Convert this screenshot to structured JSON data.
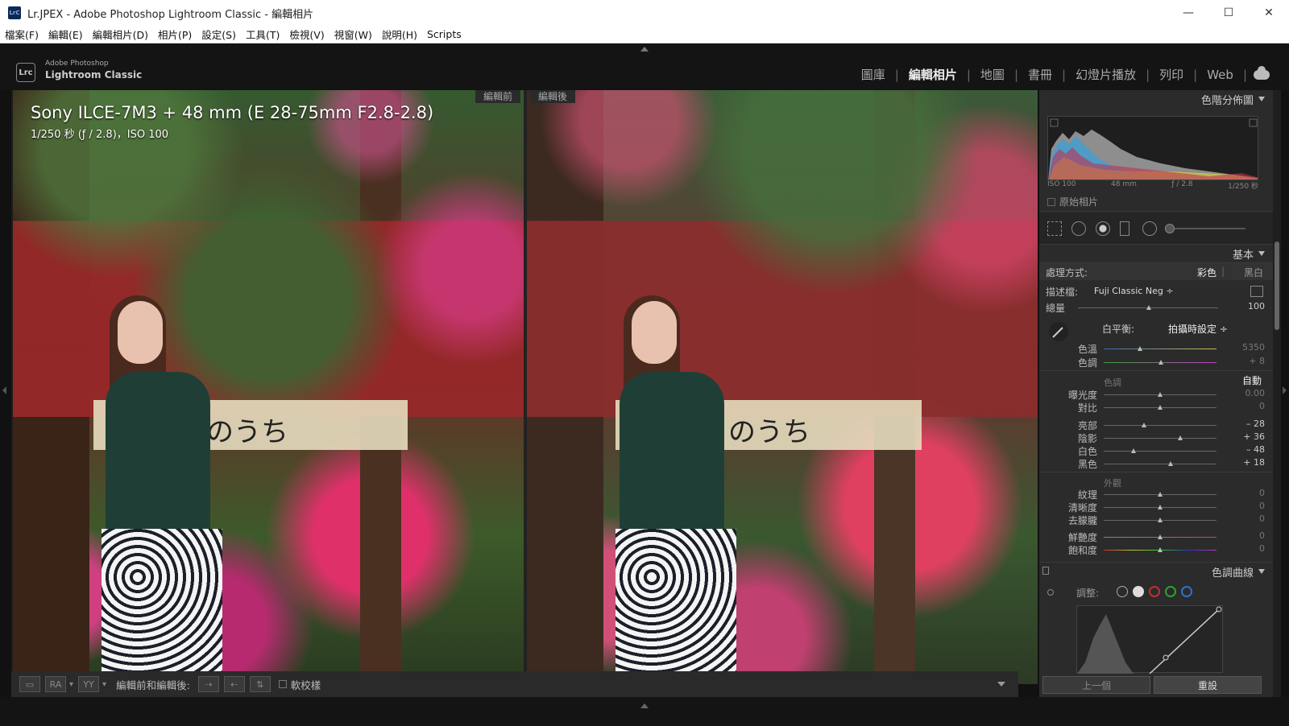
{
  "window": {
    "title": "Lr.JPEX - Adobe Photoshop Lightroom Classic - 編輯相片",
    "app_icon": "LrC",
    "minimize": "—",
    "maximize": "☐",
    "close": "✕"
  },
  "menu": [
    "檔案(F)",
    "編輯(E)",
    "編輯相片(D)",
    "相片(P)",
    "設定(S)",
    "工具(T)",
    "檢視(V)",
    "視窗(W)",
    "說明(H)",
    "Scripts"
  ],
  "brand": {
    "badge": "Lrc",
    "line1": "Adobe Photoshop",
    "line2": "Lightroom Classic"
  },
  "modules": [
    "圖庫",
    "編輯相片",
    "地圖",
    "書冊",
    "幻燈片播放",
    "列印",
    "Web"
  ],
  "module_sep": "|",
  "stage": {
    "before_label": "編輯前",
    "after_label": "編輯後",
    "exif_line1": "Sony ILCE-7M3 + 48 mm (E 28-75mm F2.8-2.8)",
    "exif_line2": "1/250 秒 (ƒ / 2.8)，ISO 100",
    "sign_text": "のうち"
  },
  "toolbar": {
    "view_rr": "RA",
    "view_yy": "YY",
    "mode_label": "編輯前和編輯後:",
    "soft_proof": "軟校樣"
  },
  "panel": {
    "histogram_title": "色階分佈圖",
    "hist_iso": "ISO 100",
    "hist_focal": "48 mm",
    "hist_aperture": "ƒ / 2.8",
    "hist_shutter": "1/250 秒",
    "original_photo": "原始相片",
    "basic_title": "基本",
    "treatment_label": "處理方式:",
    "treatment_color": "彩色",
    "treatment_bw": "黑白",
    "profile_label": "描述檔:",
    "profile_value": "Fuji Classic Neg ÷",
    "amount_label": "總量",
    "amount_value": "100",
    "wb_label": "白平衡:",
    "wb_value": "拍攝時設定 ÷",
    "temp_label": "色溫",
    "temp_value": "5350",
    "tint_label": "色調",
    "tint_value": "+ 8",
    "tone_head": "色調",
    "auto": "自動",
    "exposure_label": "曝光度",
    "exposure_value": "0.00",
    "contrast_label": "對比",
    "contrast_value": "0",
    "highlights_label": "亮部",
    "highlights_value": "– 28",
    "shadows_label": "陰影",
    "shadows_value": "+ 36",
    "whites_label": "白色",
    "whites_value": "– 48",
    "blacks_label": "黑色",
    "blacks_value": "+ 18",
    "presence_head": "外觀",
    "texture_label": "紋理",
    "texture_value": "0",
    "clarity_label": "清晰度",
    "clarity_value": "0",
    "dehaze_label": "去朦朧",
    "dehaze_value": "0",
    "vibrance_label": "鮮艷度",
    "vibrance_value": "0",
    "saturation_label": "飽和度",
    "saturation_value": "0",
    "curve_title": "色調曲線",
    "adjust_label": "調整:",
    "prev_button": "上一個",
    "reset_button": "重設"
  }
}
